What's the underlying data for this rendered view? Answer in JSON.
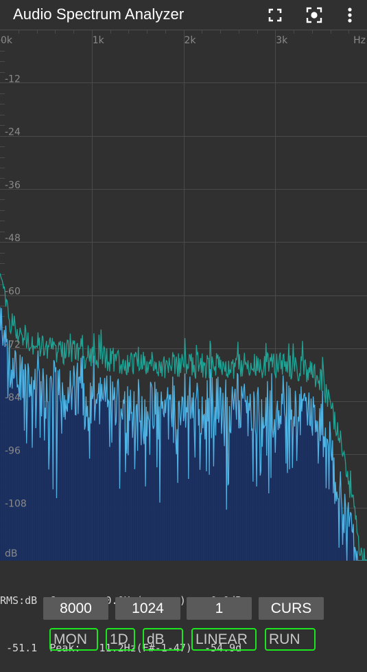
{
  "app": {
    "title": "Audio Spectrum Analyzer",
    "actions": [
      {
        "name": "fullscreen",
        "icon": "fullscreen-icon"
      },
      {
        "name": "center-focus",
        "icon": "center-focus-icon"
      },
      {
        "name": "more-options",
        "icon": "more-vert-icon"
      }
    ]
  },
  "plot": {
    "x_axis": {
      "labels": [
        "0k",
        "1k",
        "2k",
        "3k"
      ],
      "unit": "Hz",
      "min_hz": 0,
      "max_hz": 4000,
      "major_step_hz": 1000,
      "minor_step_hz": 200
    },
    "y_axis": {
      "labels": [
        "-12",
        "-24",
        "-36",
        "-48",
        "-60",
        "-72",
        "-84",
        "-96",
        "-108"
      ],
      "unit": "dB",
      "min_db": -120,
      "max_db": 0,
      "major_step_db": 12,
      "minor_step_db": 2.4
    },
    "colors": {
      "background": "#303030",
      "grid": "#4a4a4a",
      "axis_text": "#8a8a8a",
      "peak_line": "#1fa395",
      "current_line": "#4fb3e4",
      "fill": "#1c3366"
    },
    "peak_hold_profile_db": [
      [
        0,
        -56
      ],
      [
        40,
        -60
      ],
      [
        100,
        -65
      ],
      [
        180,
        -68
      ],
      [
        300,
        -70
      ],
      [
        500,
        -72
      ],
      [
        800,
        -73
      ],
      [
        1000,
        -74
      ],
      [
        1500,
        -75.5
      ],
      [
        2000,
        -76
      ],
      [
        2500,
        -76
      ],
      [
        3000,
        -76
      ],
      [
        3300,
        -76.5
      ],
      [
        3450,
        -78
      ],
      [
        3550,
        -82
      ],
      [
        3650,
        -88
      ],
      [
        3750,
        -97
      ],
      [
        3850,
        -108
      ],
      [
        3920,
        -118
      ],
      [
        4000,
        -120
      ]
    ],
    "current_offset_db": -9
  },
  "readout": {
    "line1": "RMS:dB  Cur :    0.0Hz(      )    0.0dB",
    "line2": " -51.1  Peak:   11.2Hz(F#-1-47)  -54.9d",
    "rms_label": "RMS:dB",
    "rms_value": "-51.1",
    "cursor_freq": "0.0Hz",
    "cursor_db": "0.0dB",
    "peak_freq": "11.2Hz",
    "peak_note": "F#-1-47",
    "peak_db": "-54.9d"
  },
  "controls": {
    "sample_rate": "8000",
    "fft_size": "1024",
    "averaging": "1",
    "cursor_mode": "CURS"
  },
  "toggles": {
    "monitor": "MON",
    "view": "1D",
    "scale": "dB",
    "freq_scale": "LINEAR",
    "run_state": "RUN"
  }
}
